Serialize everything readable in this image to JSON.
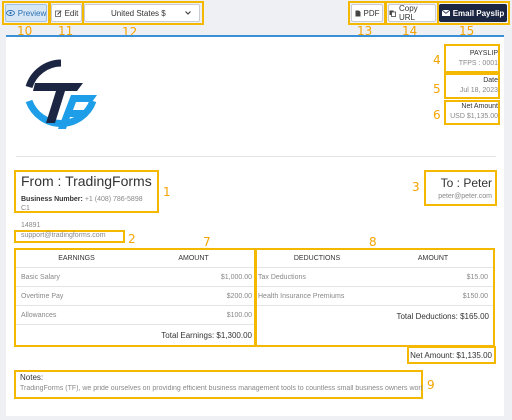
{
  "toolbar": {
    "preview_label": "Preview",
    "edit_label": "Edit",
    "currency_value": "United States $",
    "pdf_label": "PDF",
    "copy_url_label": "Copy URL",
    "email_label": "Email Payslip"
  },
  "doc": {
    "title": "PAYSLIP",
    "number": "TFPS : 0001",
    "date_label": "Date",
    "date_value": "Jul 18, 2023",
    "net_label": "Net Amount",
    "net_value": "USD $1,135.00"
  },
  "from": {
    "heading": "From : TradingForms",
    "business_number_label": "Business Number:",
    "business_number_value": "+1 (408) 786-5898",
    "line2": "C1",
    "line3": "14891",
    "email": "support@tradingforms.com"
  },
  "to": {
    "heading": "To : Peter",
    "email": "peter@peter.com"
  },
  "earnings": {
    "col1": "EARNINGS",
    "col2": "AMOUNT",
    "rows": [
      {
        "name": "Basic Salary",
        "amount": "$1,000.00"
      },
      {
        "name": "Overtime Pay",
        "amount": "$200.00"
      },
      {
        "name": "Allowances",
        "amount": "$100.00"
      }
    ],
    "total": "Total Earnings: $1,300.00"
  },
  "deductions": {
    "col1": "DEDUCTIONS",
    "col2": "AMOUNT",
    "rows": [
      {
        "name": "Tax Deductions",
        "amount": "$15.00"
      },
      {
        "name": "Health Insurance Premiums",
        "amount": "$150.00"
      }
    ],
    "total": "Total Deductions: $165.00"
  },
  "net_amount": "Net Amount: $1,135.00",
  "notes": {
    "label": "Notes:",
    "text": "TradingForms (TF), we pride ourselves on providing efficient business management tools to countless small business owners worldwide."
  },
  "annotations": [
    "1",
    "2",
    "3",
    "4",
    "5",
    "6",
    "7",
    "8",
    "9",
    "10",
    "11",
    "12",
    "13",
    "14",
    "15"
  ],
  "colors": {
    "highlight": "#f5b800",
    "accent_blue": "#3a90d6",
    "dark_button": "#1c2541",
    "logo_dark": "#1c2541",
    "logo_light": "#1e9ee8"
  }
}
